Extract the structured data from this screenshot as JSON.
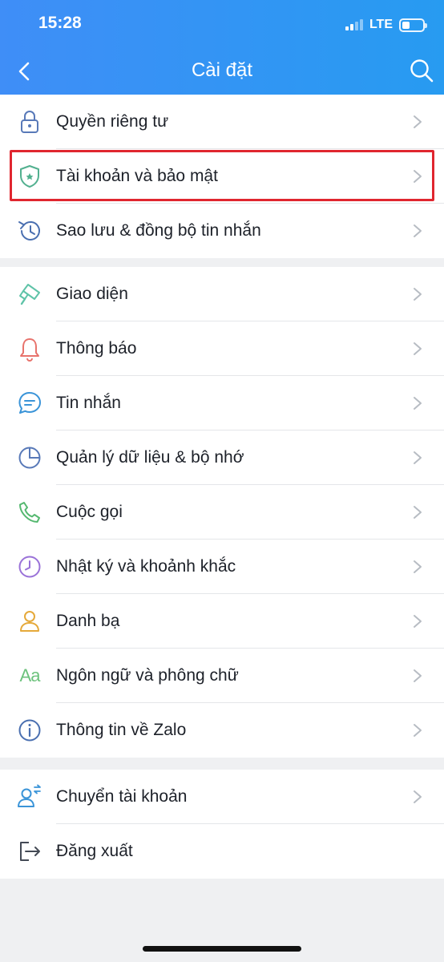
{
  "status_bar": {
    "time": "15:28",
    "network": "LTE",
    "battery_level": 0.35
  },
  "header": {
    "title": "Cài đặt"
  },
  "groups": [
    {
      "items": [
        {
          "label": "Quyền riêng tư",
          "icon": "lock-icon"
        },
        {
          "label": "Tài khoản và bảo mật",
          "icon": "shield-icon",
          "highlighted": true
        },
        {
          "label": "Sao lưu & đồng bộ tin nhắn",
          "icon": "history-icon"
        }
      ]
    },
    {
      "items": [
        {
          "label": "Giao diện",
          "icon": "paint-brush-icon"
        },
        {
          "label": "Thông báo",
          "icon": "bell-icon"
        },
        {
          "label": "Tin nhắn",
          "icon": "chat-icon"
        },
        {
          "label": "Quản lý dữ liệu & bộ nhớ",
          "icon": "pie-chart-icon"
        },
        {
          "label": "Cuộc gọi",
          "icon": "phone-icon"
        },
        {
          "label": "Nhật ký và khoảnh khắc",
          "icon": "clock-icon"
        },
        {
          "label": "Danh bạ",
          "icon": "contact-icon"
        },
        {
          "label": "Ngôn ngữ và phông chữ",
          "icon": "font-icon",
          "glyph": "Aa"
        },
        {
          "label": "Thông tin về Zalo",
          "icon": "info-icon"
        }
      ]
    },
    {
      "items": [
        {
          "label": "Chuyển tài khoản",
          "icon": "switch-account-icon"
        },
        {
          "label": "Đăng xuất",
          "icon": "logout-icon"
        }
      ]
    }
  ],
  "colors": {
    "header_start": "#3f8ef7",
    "header_end": "#279bf1",
    "highlight_border": "#e0262f"
  }
}
